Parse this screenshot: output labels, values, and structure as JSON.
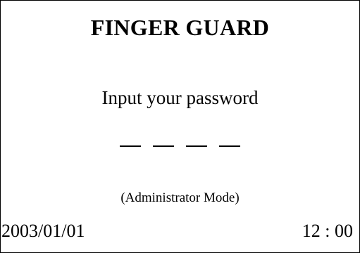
{
  "screen": {
    "title": "FINGER GUARD",
    "prompt": "Input your password",
    "password_slots": [
      "",
      "",
      "",
      ""
    ],
    "mode": "(Administrator Mode)",
    "date": "2003/01/01",
    "time": "12 : 00"
  }
}
